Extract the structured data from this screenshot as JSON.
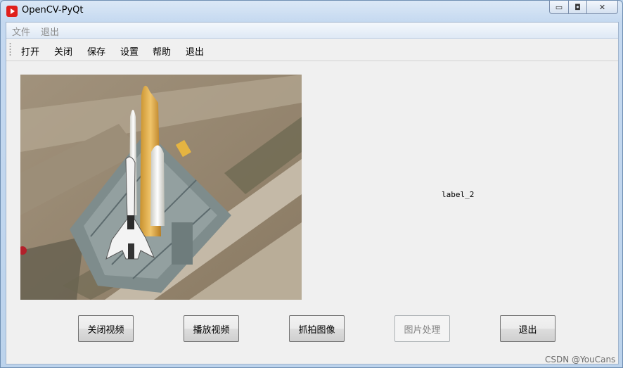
{
  "window": {
    "title": "OpenCV-PyQt",
    "min_glyph": "▭",
    "max_glyph": "◘",
    "close_glyph": "✕"
  },
  "menubar": [
    "文件",
    "退出"
  ],
  "toolbar": [
    "打开",
    "关闭",
    "保存",
    "设置",
    "帮助",
    "退出"
  ],
  "label_2": "label_2",
  "buttons": [
    {
      "label": "关闭视频",
      "enabled": true
    },
    {
      "label": "播放视频",
      "enabled": true
    },
    {
      "label": "抓拍图像",
      "enabled": true
    },
    {
      "label": "图片处理",
      "enabled": false
    },
    {
      "label": "退出",
      "enabled": true
    }
  ],
  "watermark": "CSDN @YouCans",
  "colors": {
    "accent": "#e0201c",
    "disabled_text": "#838383"
  }
}
